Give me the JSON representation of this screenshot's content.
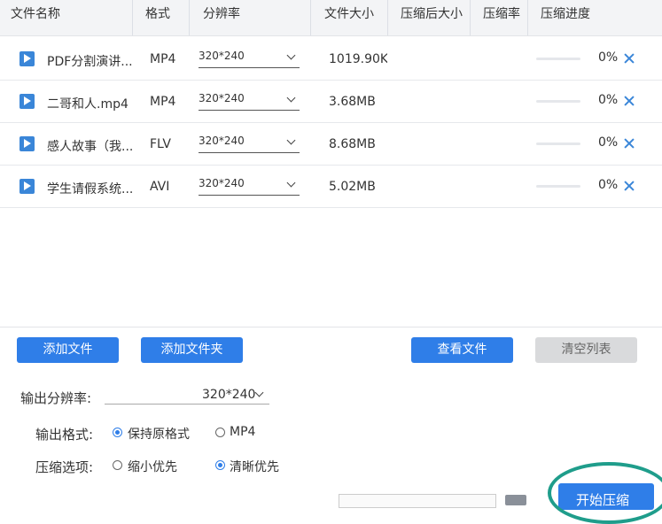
{
  "header": {
    "columns": [
      "文件名称",
      "格式",
      "分辨率",
      "文件大小",
      "压缩后大小",
      "压缩率",
      "压缩进度"
    ]
  },
  "files": [
    {
      "name": "PDF分割演讲...",
      "format": "MP4",
      "resolution": "320*240",
      "size": "1019.90KE",
      "progress_pct": 0,
      "progress_label": "0%"
    },
    {
      "name": "二哥和人.mp4",
      "format": "MP4",
      "resolution": "320*240",
      "size": "3.68MB",
      "progress_pct": 0,
      "progress_label": "0%"
    },
    {
      "name": "感人故事（我...",
      "format": "FLV",
      "resolution": "320*240",
      "size": "8.68MB",
      "progress_pct": 0,
      "progress_label": "0%"
    },
    {
      "name": "学生请假系统...",
      "format": "AVI",
      "resolution": "320*240",
      "size": "5.02MB",
      "progress_pct": 0,
      "progress_label": "0%"
    }
  ],
  "buttons": {
    "add_file": "添加文件",
    "add_folder": "添加文件夹",
    "view_file": "查看文件",
    "clear_list": "清空列表",
    "start": "开始压缩"
  },
  "output": {
    "resolution_label": "输出分辨率:",
    "resolution_value": "320*240",
    "format_label": "输出格式:",
    "format_options": [
      "保持原格式",
      "MP4"
    ],
    "format_selected": "保持原格式",
    "compress_label": "压缩选项:",
    "compress_options": [
      "缩小优先",
      "清晰优先"
    ],
    "compress_selected": "清晰优先"
  },
  "colors": {
    "accent": "#2f7ee8",
    "highlight_ring": "#1f9d8b"
  }
}
